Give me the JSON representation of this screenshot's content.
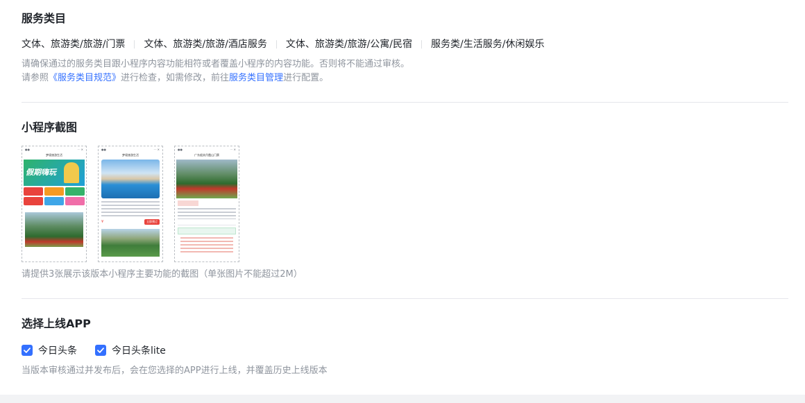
{
  "service_category": {
    "title": "服务类目",
    "categories": [
      "文体、旅游类/旅游/门票",
      "文体、旅游类/旅游/酒店服务",
      "文体、旅游类/旅游/公寓/民宿",
      "服务类/生活服务/休闲娱乐"
    ],
    "hint_line1": "请确保通过的服务类目跟小程序内容功能相符或者覆盖小程序的内容功能。否则将不能通过审核。",
    "hint_line2_prefix": "请参照",
    "hint_line2_link1": "《服务类目规范》",
    "hint_line2_mid": "进行检查，如需修改，前往",
    "hint_line2_link2": "服务类目管理",
    "hint_line2_suffix": "进行配置。"
  },
  "screenshots": {
    "title": "小程序截图",
    "hint": "请提供3张展示该版本小程序主要功能的截图（单张图片不能超过2M）",
    "items": [
      {
        "label": "screenshot-1",
        "page_title": "梦境旅游生活",
        "banner": "假期嗨玩"
      },
      {
        "label": "screenshot-2",
        "page_title": "梦境旅游生活",
        "button": "立即预订"
      },
      {
        "label": "screenshot-3",
        "page_title": "广东韶关丹霞山门票"
      }
    ]
  },
  "app_select": {
    "title": "选择上线APP",
    "options": [
      {
        "label": "今日头条",
        "checked": true
      },
      {
        "label": "今日头条lite",
        "checked": true
      }
    ],
    "hint": "当版本审核通过并发布后，会在您选择的APP进行上线，并覆盖历史上线版本"
  },
  "colors": {
    "accent": "#3370ff",
    "hint_text": "#8f959e"
  }
}
